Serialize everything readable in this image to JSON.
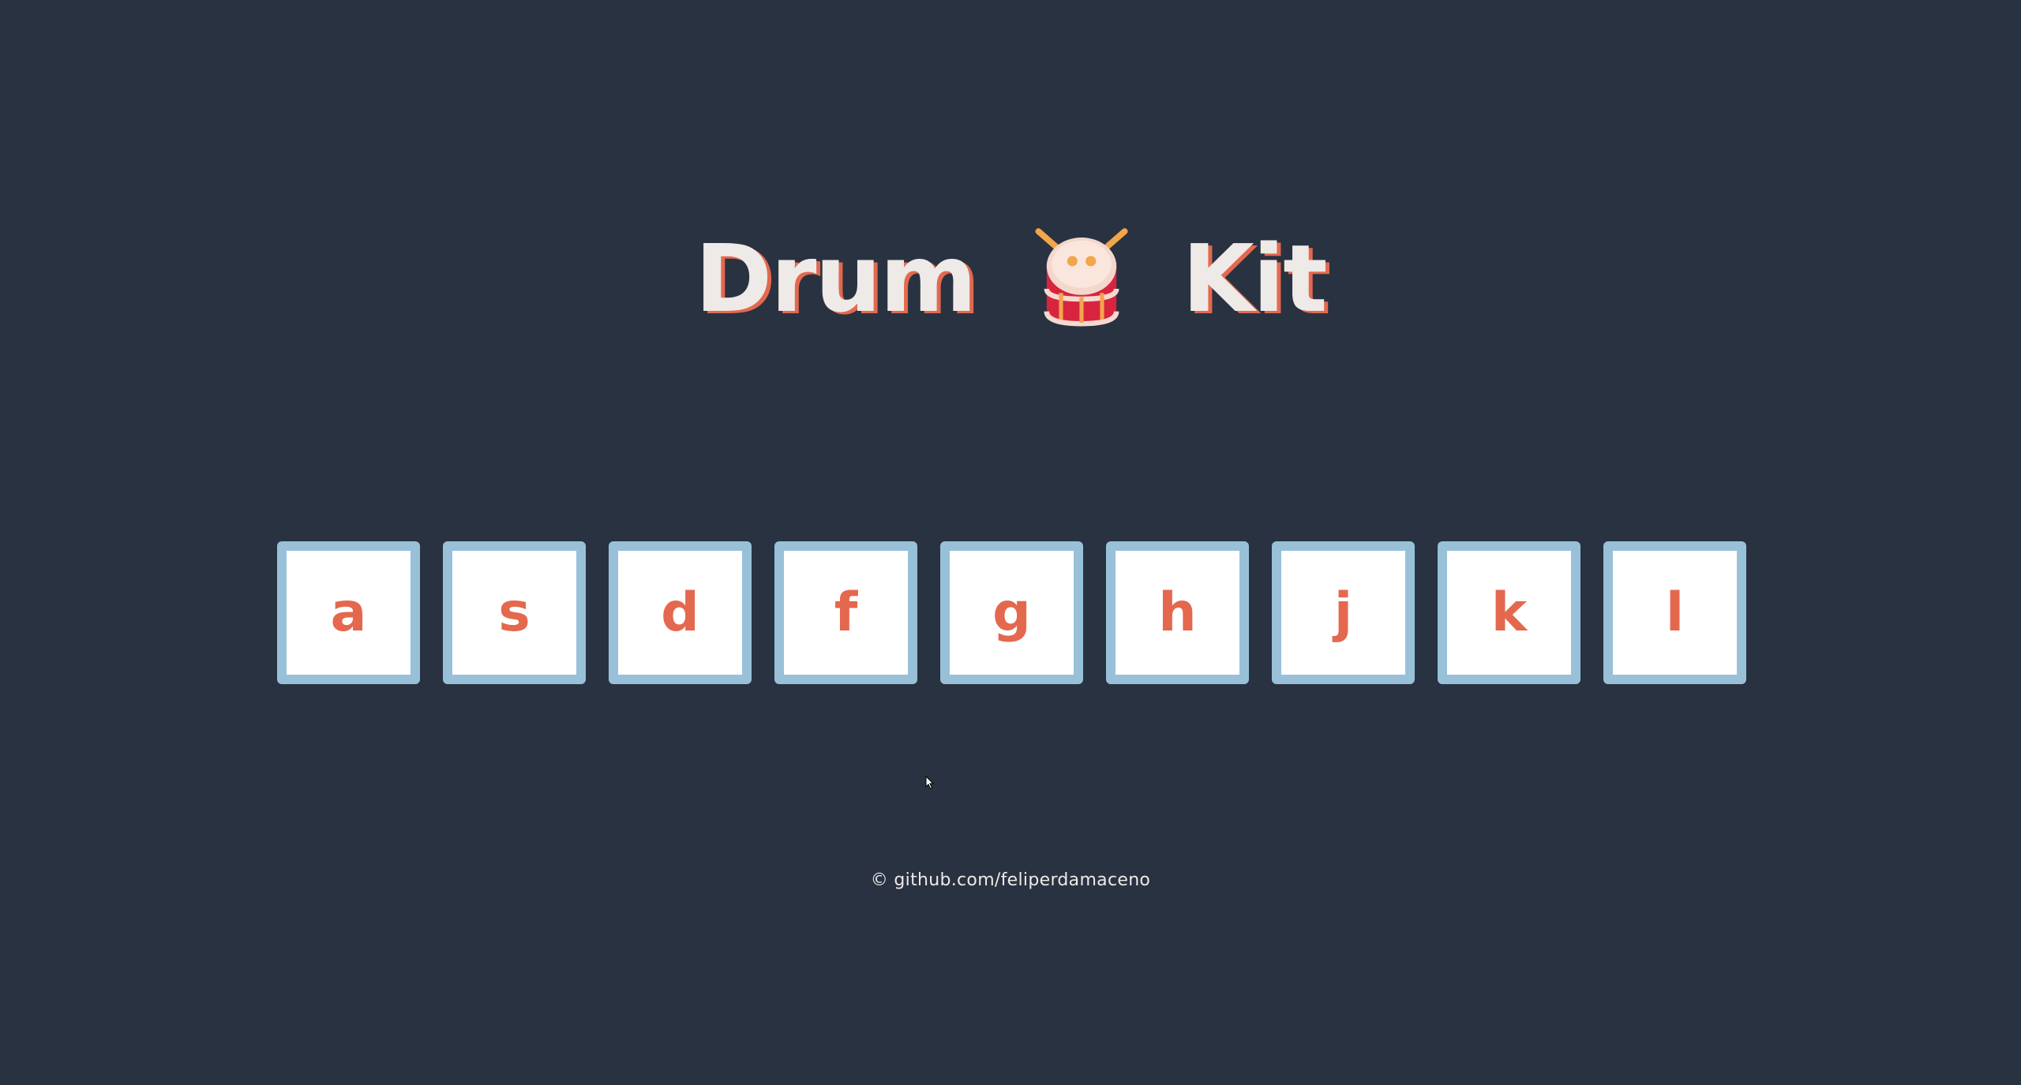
{
  "title": {
    "word_left": "Drum",
    "emoji_icon": "drum-icon",
    "word_right": "Kit"
  },
  "keys": [
    {
      "letter": "a"
    },
    {
      "letter": "s"
    },
    {
      "letter": "d"
    },
    {
      "letter": "f"
    },
    {
      "letter": "g"
    },
    {
      "letter": "h"
    },
    {
      "letter": "j"
    },
    {
      "letter": "k"
    },
    {
      "letter": "l"
    }
  ],
  "footer": {
    "copyright_symbol": "©",
    "link_text": "github.com/feliperdamaceno"
  },
  "colors": {
    "background": "#293241",
    "key_border": "#98c1d9",
    "accent": "#e4684e",
    "title_text": "#eeeae7"
  }
}
